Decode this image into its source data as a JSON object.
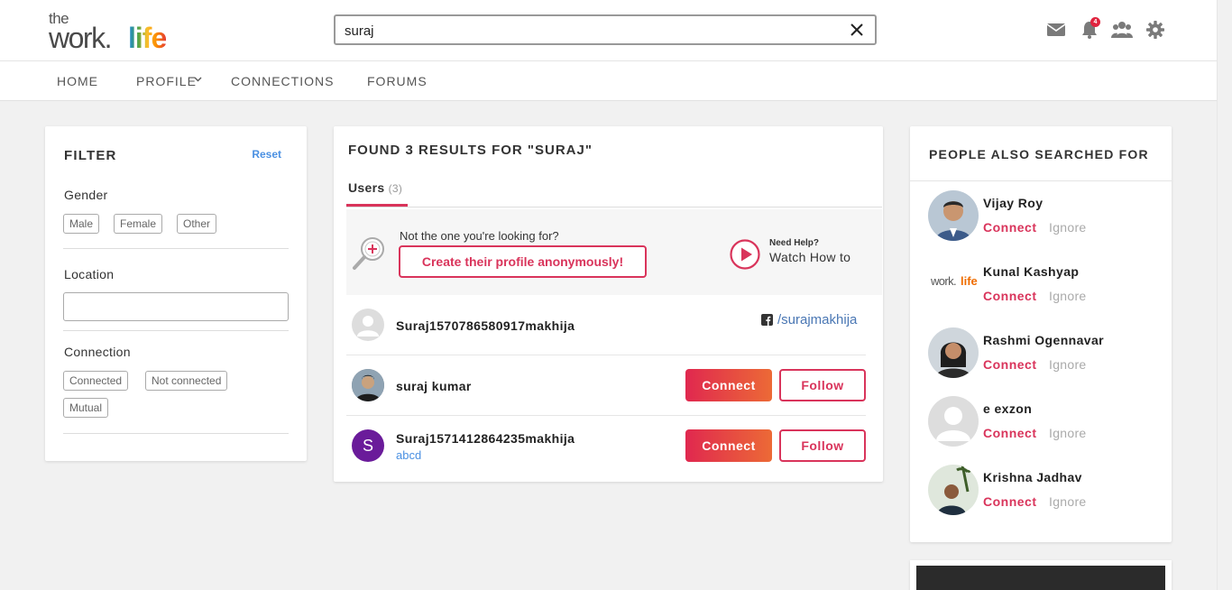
{
  "logo": {
    "top": "the",
    "work": "work.",
    "life": "life"
  },
  "search": {
    "value": "suraj",
    "placeholder": ""
  },
  "header_icons": {
    "mail": "mail-icon",
    "bell": "bell-icon",
    "bell_badge": "4",
    "people": "people-icon",
    "settings": "gear-icon"
  },
  "nav": {
    "home": "HOME",
    "profile": "PROFILE",
    "connections": "CONNECTIONS",
    "forums": "FORUMS"
  },
  "filter": {
    "title": "FILTER",
    "reset": "Reset",
    "gender_label": "Gender",
    "gender_options": [
      "Male",
      "Female",
      "Other"
    ],
    "location_label": "Location",
    "location_value": "",
    "connection_label": "Connection",
    "connection_options": [
      "Connected",
      "Not connected",
      "Mutual"
    ]
  },
  "results": {
    "heading": "FOUND 3 RESULTS FOR \"SURAJ\"",
    "tab_label": "Users",
    "tab_count": "(3)",
    "help_prompt": "Not the one you're looking for?",
    "create_button": "Create their profile anonymously!",
    "need_help": "Need Help?",
    "watch_how": "Watch How to",
    "users": [
      {
        "name": "Suraj1570786580917makhija",
        "sub": "",
        "facebook": "/surajmakhija"
      },
      {
        "name": "suraj kumar",
        "sub": "",
        "connect": "Connect",
        "follow": "Follow"
      },
      {
        "name": "Suraj1571412864235makhija",
        "sub": "abcd",
        "initial": "S",
        "connect": "Connect",
        "follow": "Follow"
      }
    ]
  },
  "people_also": {
    "title": "PEOPLE ALSO SEARCHED FOR",
    "connect_label": "Connect",
    "ignore_label": "Ignore",
    "people": [
      {
        "name": "Vijay Roy"
      },
      {
        "name": "Kunal Kashyap",
        "logo_work": "work.",
        "logo_life": "life"
      },
      {
        "name": "Rashmi Ogennavar"
      },
      {
        "name": "e exzon"
      },
      {
        "name": "Krishna Jadhav"
      }
    ]
  },
  "colors": {
    "accent": "#d9345b",
    "link": "#4a90e2",
    "avatar_purple": "#6a1b9a"
  }
}
